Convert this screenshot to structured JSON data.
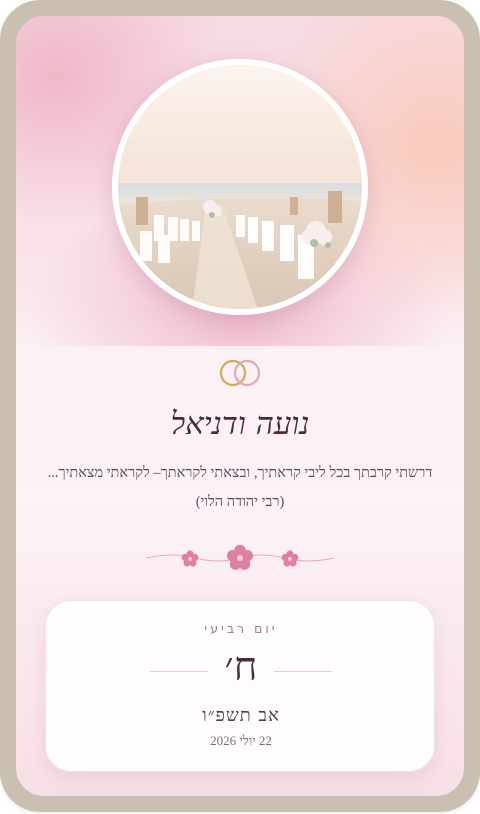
{
  "couple": {
    "names": "נועה ודניאל"
  },
  "verse": {
    "text": "דרשתי קרבתך בכל ליבי קראתיך, ובצאתי לקראתך– לקראתי מצאתיך...(רבי יהודה הלוי)"
  },
  "date": {
    "weekday": "יום רביעי",
    "day": "ח׳",
    "hebrew_month_year": "אב תשפ״ו",
    "gregorian": "22 יולי 2026"
  },
  "icons": {
    "rings": "wedding-rings-icon",
    "divider": "flower-divider-icon"
  },
  "colors": {
    "frame": "#c9c0b1",
    "accent_pink": "#e07fa4",
    "ring_gold": "#d4a85c",
    "text_dark": "#4a2a38"
  }
}
